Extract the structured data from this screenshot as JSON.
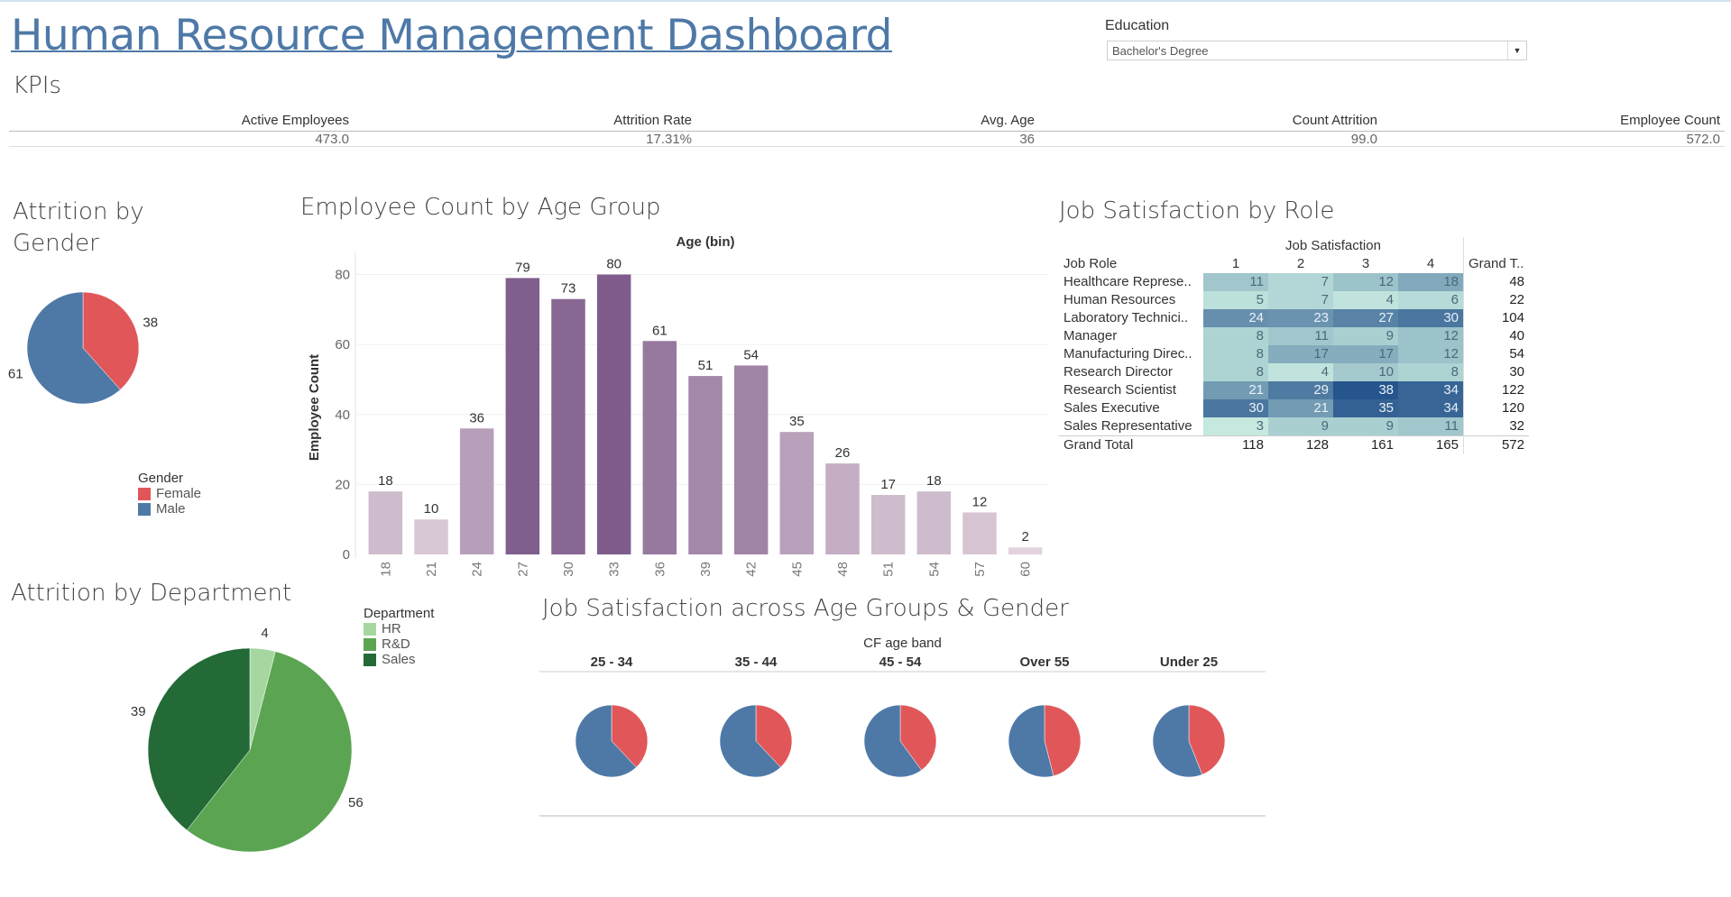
{
  "dashboard": {
    "title": "Human Resource Management Dashboard",
    "filter": {
      "label": "Education",
      "value": "Bachelor's Degree"
    }
  },
  "kpis": {
    "section_title": "KPIs",
    "items": [
      {
        "label": "Active Employees",
        "value": "473.0"
      },
      {
        "label": "Attrition Rate",
        "value": "17.31%"
      },
      {
        "label": "Avg. Age",
        "value": "36"
      },
      {
        "label": "Count Attrition",
        "value": "99.0"
      },
      {
        "label": "Employee Count",
        "value": "572.0"
      }
    ]
  },
  "colors": {
    "female": "#e15759",
    "male": "#4e79a7",
    "hr": "#a6d7a0",
    "rnd": "#5ba552",
    "sales": "#236a37"
  },
  "chart_data": [
    {
      "id": "gender",
      "type": "pie",
      "title": "Attrition by Gender",
      "legend_title": "Gender",
      "slices": [
        {
          "name": "Female",
          "value": 38
        },
        {
          "name": "Male",
          "value": 61
        }
      ]
    },
    {
      "id": "age",
      "type": "bar",
      "title": "Employee Count by Age Group",
      "xlabel": "Age (bin)",
      "ylabel": "Employee Count",
      "categories": [
        "18",
        "21",
        "24",
        "27",
        "30",
        "33",
        "36",
        "39",
        "42",
        "45",
        "48",
        "51",
        "54",
        "57",
        "60"
      ],
      "values": [
        18,
        10,
        36,
        79,
        73,
        80,
        61,
        51,
        54,
        35,
        26,
        17,
        18,
        12,
        2
      ],
      "yticks": [
        0,
        20,
        40,
        60,
        80
      ],
      "ylim": [
        0,
        84
      ]
    },
    {
      "id": "jobsat",
      "type": "heatmap",
      "title": "Job Satisfaction by Role",
      "column_group": "Job Satisfaction",
      "row_header": "Job Role",
      "columns": [
        "1",
        "2",
        "3",
        "4"
      ],
      "total_header": "Grand T..",
      "rows": [
        {
          "role": "Healthcare Represe..",
          "values": [
            11,
            7,
            12,
            18
          ],
          "total": 48
        },
        {
          "role": "Human Resources",
          "values": [
            5,
            7,
            4,
            6
          ],
          "total": 22
        },
        {
          "role": "Laboratory Technici..",
          "values": [
            24,
            23,
            27,
            30
          ],
          "total": 104
        },
        {
          "role": "Manager",
          "values": [
            8,
            11,
            9,
            12
          ],
          "total": 40
        },
        {
          "role": "Manufacturing Direc..",
          "values": [
            8,
            17,
            17,
            12
          ],
          "total": 54
        },
        {
          "role": "Research Director",
          "values": [
            8,
            4,
            10,
            8
          ],
          "total": 30
        },
        {
          "role": "Research Scientist",
          "values": [
            21,
            29,
            38,
            34
          ],
          "total": 122
        },
        {
          "role": "Sales Executive",
          "values": [
            30,
            21,
            35,
            34
          ],
          "total": 120
        },
        {
          "role": "Sales Representative",
          "values": [
            3,
            9,
            9,
            11
          ],
          "total": 32
        }
      ],
      "grand_total": {
        "label": "Grand Total",
        "values": [
          118,
          128,
          161,
          165
        ],
        "total": 572
      }
    },
    {
      "id": "department",
      "type": "pie",
      "title": "Attrition by Department",
      "legend_title": "Department",
      "slices": [
        {
          "name": "HR",
          "value": 4
        },
        {
          "name": "R&D",
          "value": 56
        },
        {
          "name": "Sales",
          "value": 39
        }
      ]
    },
    {
      "id": "agegender",
      "type": "pie",
      "title": "Job Satisfaction across Age Groups & Gender",
      "column_group": "CF age band",
      "groups": [
        {
          "band": "25 - 34",
          "female": 0.38,
          "male": 0.62
        },
        {
          "band": "35 - 44",
          "female": 0.38,
          "male": 0.62
        },
        {
          "band": "45 - 54",
          "female": 0.4,
          "male": 0.6
        },
        {
          "band": "Over 55",
          "female": 0.46,
          "male": 0.54
        },
        {
          "band": "Under 25",
          "female": 0.44,
          "male": 0.56
        }
      ]
    }
  ]
}
